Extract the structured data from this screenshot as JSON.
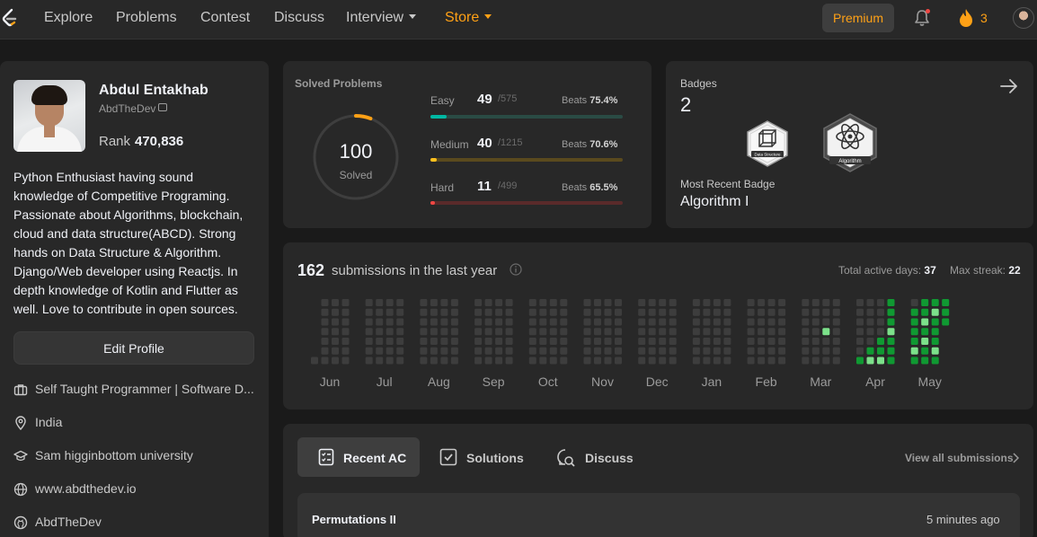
{
  "nav": {
    "items": [
      {
        "label": "Explore",
        "dropdown": false
      },
      {
        "label": "Problems",
        "dropdown": false
      },
      {
        "label": "Contest",
        "dropdown": false
      },
      {
        "label": "Discuss",
        "dropdown": false
      },
      {
        "label": "Interview",
        "dropdown": true
      },
      {
        "label": "Store",
        "dropdown": true
      }
    ],
    "premium_label": "Premium",
    "streak_count": "3",
    "accent": "#ffa116"
  },
  "profile": {
    "name": "Abdul Entakhab",
    "username": "AbdTheDev",
    "rank_label": "Rank",
    "rank_value": "470,836",
    "bio": "Python Enthusiast having sound knowledge of Competitive Programing. Passionate about Algorithms, blockchain, cloud and data structure(ABCD). Strong hands on Data Structure & Algorithm. Django/Web developer using Reactjs. In depth knowledge of Kotlin and Flutter as well. Love to contribute in open sources.",
    "edit_button": "Edit Profile",
    "info": [
      {
        "icon": "briefcase-icon",
        "text": "Self Taught Programmer | Software D..."
      },
      {
        "icon": "location-icon",
        "text": "India"
      },
      {
        "icon": "graduation-cap-icon",
        "text": "Sam higginbottom university"
      },
      {
        "icon": "globe-icon",
        "text": "www.abdthedev.io"
      },
      {
        "icon": "github-icon",
        "text": "AbdTheDev"
      }
    ]
  },
  "solved": {
    "title": "Solved Problems",
    "total": "100",
    "total_label": "Solved",
    "ring_fraction": 0.058,
    "difficulties": [
      {
        "label": "Easy",
        "count": "49",
        "total": "/575",
        "beats_label": "Beats",
        "beats": "75.4%",
        "fraction": 0.085,
        "color": "#00b8a3",
        "track": "#2a4b44"
      },
      {
        "label": "Medium",
        "count": "40",
        "total": "/1215",
        "beats_label": "Beats",
        "beats": "70.6%",
        "fraction": 0.033,
        "color": "#ffc01e",
        "track": "#5a4a1e"
      },
      {
        "label": "Hard",
        "count": "11",
        "total": "/499",
        "beats_label": "Beats",
        "beats": "65.5%",
        "fraction": 0.022,
        "color": "#ef4743",
        "track": "#5a2a2a"
      }
    ]
  },
  "badges": {
    "label": "Badges",
    "count": "2",
    "items": [
      {
        "name": "Data Structure",
        "icon": "cube-icon"
      },
      {
        "name": "Algorithm",
        "icon": "atom-icon"
      }
    ],
    "recent_label": "Most Recent Badge",
    "recent_value": "Algorithm I"
  },
  "submissions": {
    "count": "162",
    "text": "submissions in the last year",
    "active_days_label": "Total active days:",
    "active_days": "37",
    "max_streak_label": "Max streak:",
    "max_streak": "22",
    "months": [
      "Jun",
      "Jul",
      "Aug",
      "Sep",
      "Oct",
      "Nov",
      "Dec",
      "Jan",
      "Feb",
      "Mar",
      "Apr",
      "May"
    ],
    "active_cells": [
      {
        "month": 9,
        "week": 2,
        "day": 3,
        "level": 2
      },
      {
        "month": 10,
        "week": 0,
        "day": 6,
        "level": 1
      },
      {
        "month": 10,
        "week": 1,
        "day": 5,
        "level": 1
      },
      {
        "month": 10,
        "week": 1,
        "day": 6,
        "level": 2
      },
      {
        "month": 10,
        "week": 2,
        "day": 4,
        "level": 1
      },
      {
        "month": 10,
        "week": 2,
        "day": 5,
        "level": 1
      },
      {
        "month": 10,
        "week": 2,
        "day": 6,
        "level": 2
      },
      {
        "month": 10,
        "week": 3,
        "day": 0,
        "level": 1
      },
      {
        "month": 10,
        "week": 3,
        "day": 1,
        "level": 1
      },
      {
        "month": 10,
        "week": 3,
        "day": 2,
        "level": 1
      },
      {
        "month": 10,
        "week": 3,
        "day": 3,
        "level": 2
      },
      {
        "month": 10,
        "week": 3,
        "day": 4,
        "level": 1
      },
      {
        "month": 10,
        "week": 3,
        "day": 5,
        "level": 1
      },
      {
        "month": 10,
        "week": 3,
        "day": 6,
        "level": 1
      },
      {
        "month": 11,
        "week": 0,
        "day": 1,
        "level": 1
      },
      {
        "month": 11,
        "week": 0,
        "day": 2,
        "level": 1
      },
      {
        "month": 11,
        "week": 0,
        "day": 3,
        "level": 1
      },
      {
        "month": 11,
        "week": 0,
        "day": 4,
        "level": 1
      },
      {
        "month": 11,
        "week": 0,
        "day": 5,
        "level": 2
      },
      {
        "month": 11,
        "week": 0,
        "day": 6,
        "level": 1
      },
      {
        "month": 11,
        "week": 1,
        "day": 0,
        "level": 1
      },
      {
        "month": 11,
        "week": 1,
        "day": 1,
        "level": 1
      },
      {
        "month": 11,
        "week": 1,
        "day": 2,
        "level": 2
      },
      {
        "month": 11,
        "week": 1,
        "day": 3,
        "level": 1
      },
      {
        "month": 11,
        "week": 1,
        "day": 4,
        "level": 2
      },
      {
        "month": 11,
        "week": 1,
        "day": 5,
        "level": 1
      },
      {
        "month": 11,
        "week": 1,
        "day": 6,
        "level": 1
      },
      {
        "month": 11,
        "week": 2,
        "day": 0,
        "level": 1
      },
      {
        "month": 11,
        "week": 2,
        "day": 1,
        "level": 2
      },
      {
        "month": 11,
        "week": 2,
        "day": 2,
        "level": 1
      },
      {
        "month": 11,
        "week": 2,
        "day": 3,
        "level": 1
      },
      {
        "month": 11,
        "week": 2,
        "day": 4,
        "level": 1
      },
      {
        "month": 11,
        "week": 2,
        "day": 5,
        "level": 2
      },
      {
        "month": 11,
        "week": 2,
        "day": 6,
        "level": 1
      },
      {
        "month": 11,
        "week": 3,
        "day": 0,
        "level": 1
      },
      {
        "month": 11,
        "week": 3,
        "day": 1,
        "level": 1
      },
      {
        "month": 11,
        "week": 3,
        "day": 2,
        "level": 1
      }
    ],
    "colors": {
      "empty": "#3d3d3d",
      "level1": "#109932",
      "level2": "#7ce18a"
    }
  },
  "recent": {
    "tabs": [
      {
        "label": "Recent AC",
        "icon": "checklist-icon",
        "active": true
      },
      {
        "label": "Solutions",
        "icon": "check-square-icon",
        "active": false
      },
      {
        "label": "Discuss",
        "icon": "discuss-search-icon",
        "active": false
      }
    ],
    "view_all": "View all submissions",
    "items": [
      {
        "title": "Permutations II",
        "time": "5 minutes ago"
      }
    ]
  }
}
